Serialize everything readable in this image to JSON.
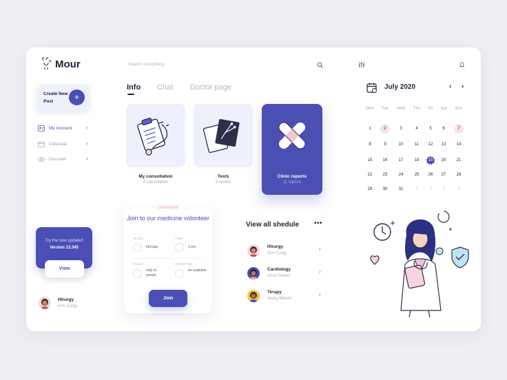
{
  "app": {
    "name": "Mour"
  },
  "colors": {
    "accent": "#4b4fb4",
    "pink": "#f0a0b8",
    "bg": "#eeeff3"
  },
  "sidebar": {
    "create_post": "Create New Post",
    "items": [
      {
        "label": "My Account",
        "icon": "user-card-icon"
      },
      {
        "label": "Calendar",
        "icon": "calendar-icon"
      },
      {
        "label": "Discover",
        "icon": "eye-icon"
      }
    ],
    "promo": {
      "line1": "Try the new updated",
      "line2": "Version 13.345",
      "button": "View"
    },
    "user": {
      "name": "Hirurgy",
      "sub": "Ann Curgy"
    }
  },
  "search": {
    "placeholder": "Search everything"
  },
  "tabs": [
    "Info",
    "Chat",
    "Doctor page"
  ],
  "services": [
    {
      "label": "My consultation",
      "sub": "4 consultation",
      "icon": "clipboard-stethoscope-icon"
    },
    {
      "label": "Tests",
      "sub": "3 results",
      "icon": "xray-icon"
    },
    {
      "label": "Clinic reports",
      "sub": "11 reports",
      "icon": "bandage-icon"
    }
  ],
  "volunteer": {
    "community": "Community",
    "title": "Join to our medicine volonteer",
    "fields": [
      {
        "head": "PLACE",
        "value": "Monday"
      },
      {
        "head": "TIME",
        "value": "3 pm"
      },
      {
        "head": "GOALS",
        "value": "help to people"
      },
      {
        "head": "CONDITION",
        "value": "be available"
      }
    ],
    "button": "Join"
  },
  "schedule": {
    "title": "View all shedule",
    "more": "•••",
    "items": [
      {
        "name": "Hirurgy",
        "sub": "Ann Curgy"
      },
      {
        "name": "Cardiology",
        "sub": "Arise Finsen"
      },
      {
        "name": "Terapy",
        "sub": "Andry Wilson"
      }
    ]
  },
  "calendar": {
    "month": "July 2020",
    "weekdays": [
      "Mon",
      "Tue",
      "Wed",
      "Thu",
      "Fri",
      "Sat",
      "Sun"
    ],
    "weeks": [
      [
        "1",
        "2",
        "3",
        "4",
        "5",
        "6",
        "7"
      ],
      [
        "8",
        "9",
        "10",
        "11",
        "12",
        "13",
        "14"
      ],
      [
        "15",
        "16",
        "17",
        "18",
        "19",
        "20",
        "21"
      ],
      [
        "22",
        "23",
        "24",
        "25",
        "26",
        "27",
        "28"
      ],
      [
        "29",
        "30",
        "31",
        "1",
        "2",
        "3",
        "4"
      ]
    ],
    "highlight_pink": [
      "2",
      "7"
    ],
    "highlight_blue": [
      "19"
    ]
  }
}
